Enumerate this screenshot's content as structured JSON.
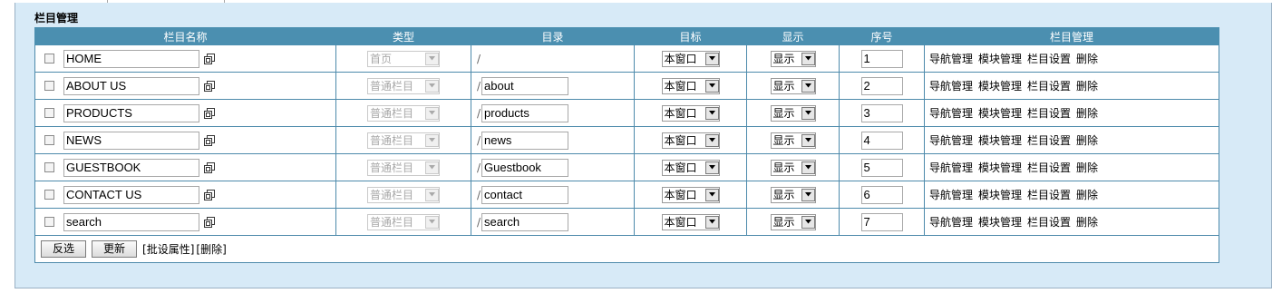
{
  "panel": {
    "title": "栏目管理"
  },
  "columns": [
    "栏目名称",
    "类型",
    "目录",
    "目标",
    "显示",
    "序号",
    "栏目管理"
  ],
  "rows": [
    {
      "name": "HOME",
      "type": "首页",
      "dir_prefix": "/",
      "dir": "",
      "target": "本窗口",
      "display": "显示",
      "order": "1"
    },
    {
      "name": "ABOUT US",
      "type": "普通栏目",
      "dir_prefix": "/",
      "dir": "about",
      "target": "本窗口",
      "display": "显示",
      "order": "2"
    },
    {
      "name": "PRODUCTS",
      "type": "普通栏目",
      "dir_prefix": "/",
      "dir": "products",
      "target": "本窗口",
      "display": "显示",
      "order": "3"
    },
    {
      "name": "NEWS",
      "type": "普通栏目",
      "dir_prefix": "/",
      "dir": "news",
      "target": "本窗口",
      "display": "显示",
      "order": "4"
    },
    {
      "name": "GUESTBOOK",
      "type": "普通栏目",
      "dir_prefix": "/",
      "dir": "Guestbook",
      "target": "本窗口",
      "display": "显示",
      "order": "5"
    },
    {
      "name": "CONTACT US",
      "type": "普通栏目",
      "dir_prefix": "/",
      "dir": "contact",
      "target": "本窗口",
      "display": "显示",
      "order": "6"
    },
    {
      "name": "search",
      "type": "普通栏目",
      "dir_prefix": "/",
      "dir": "search",
      "target": "本窗口",
      "display": "显示",
      "order": "7"
    }
  ],
  "row_links": [
    "导航管理",
    "模块管理",
    "栏目设置",
    "删除"
  ],
  "footer": {
    "invert_button": "反选",
    "update_button": "更新",
    "batch_link": "[批设属性]",
    "delete_link": "[删除]"
  },
  "icons": {
    "copy": "copy-icon",
    "dropdown": "chevron-down-icon"
  },
  "colors": {
    "header_bg": "#4b8fb0",
    "panel_bg": "#d7eaf7",
    "border": "#4d8aab"
  }
}
